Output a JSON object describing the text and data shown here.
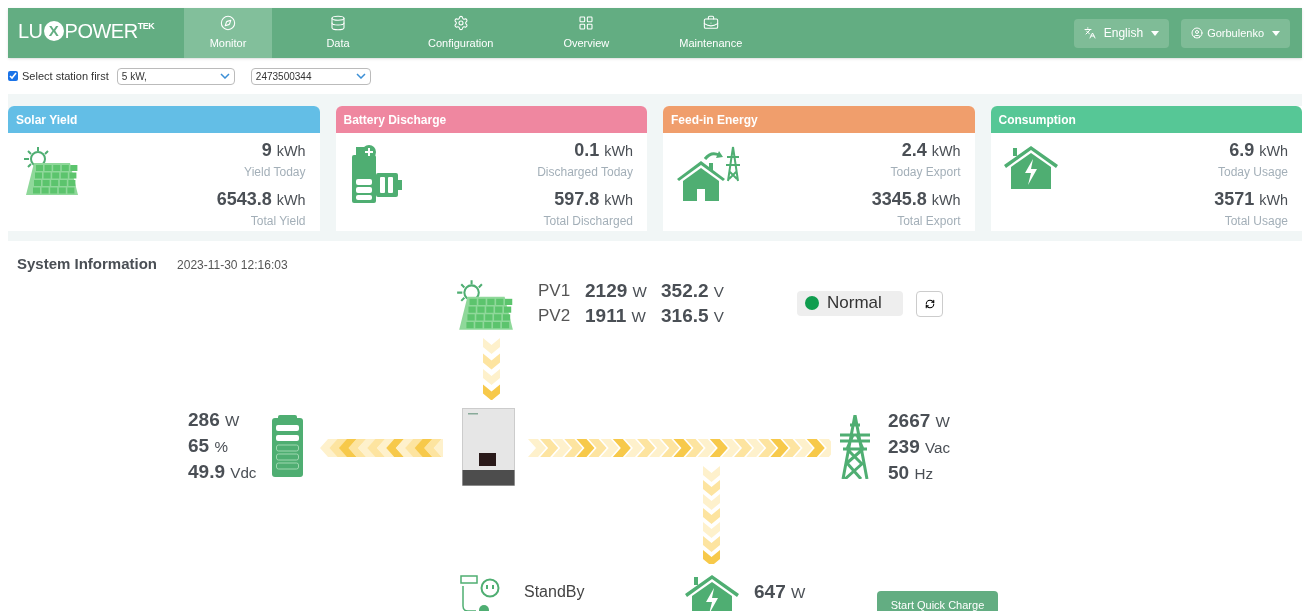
{
  "header": {
    "logo": [
      {
        "text": "LU",
        "kind": "plain"
      },
      {
        "text": "X",
        "kind": "circled"
      },
      {
        "text": "POWER",
        "kind": "plain"
      },
      {
        "text": "TEK",
        "kind": "super"
      }
    ],
    "nav": [
      {
        "label": "Monitor",
        "kind": "compass",
        "selected": true
      },
      {
        "label": "Data",
        "kind": "database",
        "selected": false
      },
      {
        "label": "Configuration",
        "kind": "gear",
        "selected": false
      },
      {
        "label": "Overview",
        "kind": "grid",
        "selected": false
      },
      {
        "label": "Maintenance",
        "kind": "briefcase",
        "selected": false
      }
    ],
    "language": "English",
    "user": "Gorbulenko"
  },
  "station": {
    "checked": true,
    "label": "Select station first",
    "station_value": "5 kW,",
    "device_value": "2473500344"
  },
  "cards": [
    {
      "title": "Solar Yield",
      "color": "#63bee6",
      "kind": "solar",
      "today": "9",
      "today_unit": "kWh",
      "today_label": "Yield Today",
      "total": "6543.8",
      "total_unit": "kWh",
      "total_label": "Total Yield"
    },
    {
      "title": "Battery Discharge",
      "color": "#ef87a0",
      "kind": "battery",
      "today": "0.1",
      "today_unit": "kWh",
      "today_label": "Discharged Today",
      "total": "597.8",
      "total_unit": "kWh",
      "total_label": "Total Discharged"
    },
    {
      "title": "Feed-in Energy",
      "color": "#f09e6c",
      "kind": "export",
      "today": "2.4",
      "today_unit": "kWh",
      "today_label": "Today Export",
      "total": "3345.8",
      "total_unit": "kWh",
      "total_label": "Total Export"
    },
    {
      "title": "Consumption",
      "color": "#56c796",
      "kind": "home",
      "today": "6.9",
      "today_unit": "kWh",
      "today_label": "Today Usage",
      "total": "3571",
      "total_unit": "kWh",
      "total_label": "Total Usage"
    }
  ],
  "system": {
    "title": "System Information",
    "time": "2023-11-30 12:16:03",
    "pv": [
      {
        "label": "PV1",
        "power": "2129",
        "power_unit": "W",
        "voltage": "352.2",
        "voltage_unit": "V"
      },
      {
        "label": "PV2",
        "power": "1911",
        "power_unit": "W",
        "voltage": "316.5",
        "voltage_unit": "V"
      }
    ],
    "status": {
      "text": "Normal",
      "color": "#109d4f"
    },
    "battery": [
      {
        "value": "286",
        "unit": "W"
      },
      {
        "value": "65",
        "unit": "%"
      },
      {
        "value": "49.9",
        "unit": "Vdc"
      }
    ],
    "grid": [
      {
        "value": "2667",
        "unit": "W"
      },
      {
        "value": "239",
        "unit": "Vac"
      },
      {
        "value": "50",
        "unit": "Hz"
      }
    ],
    "load": {
      "value": "647",
      "unit": "W"
    },
    "eps": {
      "status": "StandBy"
    },
    "quick_charge": "Start Quick Charge"
  }
}
